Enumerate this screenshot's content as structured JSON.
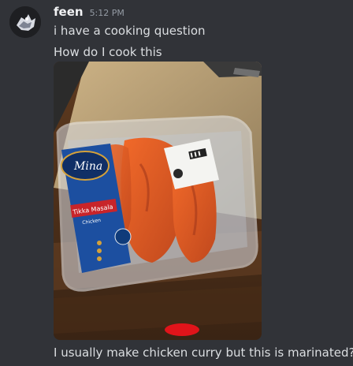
{
  "message": {
    "author": "feen",
    "timestamp": "5:12 PM",
    "lines": [
      "i have a cooking question",
      "How do I cook this"
    ],
    "caption": "I usually make chicken curry but this is marinated???"
  },
  "attachment": {
    "package_brand": "Mina",
    "package_product": "Tikka Masala",
    "package_subtitle": "Chicken"
  },
  "colors": {
    "background": "#313338",
    "text": "#dbdee1",
    "muted": "#949ba4",
    "username": "#f2f3f5"
  },
  "icons": {
    "avatar": "avatar-icon"
  }
}
